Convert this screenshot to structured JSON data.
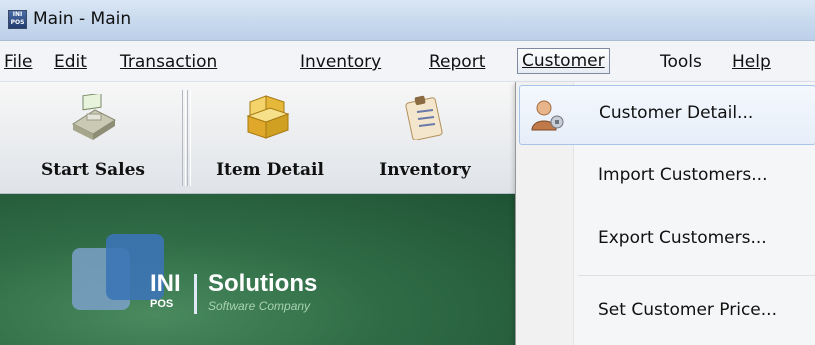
{
  "window": {
    "title": "Main - Main",
    "icon": "ini-pos-app-icon"
  },
  "menubar": {
    "items": [
      {
        "label": "File",
        "mnemonic": "F"
      },
      {
        "label": "Edit",
        "mnemonic": "E"
      },
      {
        "label": "Transaction",
        "mnemonic": "T"
      },
      {
        "label": "Inventory",
        "mnemonic": "I"
      },
      {
        "label": "Report",
        "mnemonic": "R"
      },
      {
        "label": "Customer",
        "mnemonic": "C",
        "active": true
      },
      {
        "label": "Tools",
        "mnemonic": "o"
      },
      {
        "label": "Help",
        "mnemonic": "H"
      }
    ]
  },
  "toolbar": {
    "buttons": [
      {
        "label": "Start Sales",
        "icon": "cash-register-icon"
      },
      {
        "label": "Item Detail",
        "icon": "boxes-icon"
      },
      {
        "label": "Inventory",
        "icon": "clipboard-icon"
      }
    ]
  },
  "banner": {
    "logo_ini": "INI",
    "logo_pos": "POS",
    "logo_solutions": "Solutions",
    "logo_tagline": "Software Company"
  },
  "customer_menu": {
    "items": [
      {
        "label": "Customer Detail...",
        "icon": "customer-icon",
        "highlighted": true
      },
      {
        "label": "Import Customers..."
      },
      {
        "label": "Export Customers..."
      },
      {
        "label": "Set Customer Price..."
      }
    ]
  },
  "colors": {
    "banner_green": "#2f6c46",
    "menu_highlight": "#a8c4e8",
    "titlebar": "#c9daee"
  }
}
